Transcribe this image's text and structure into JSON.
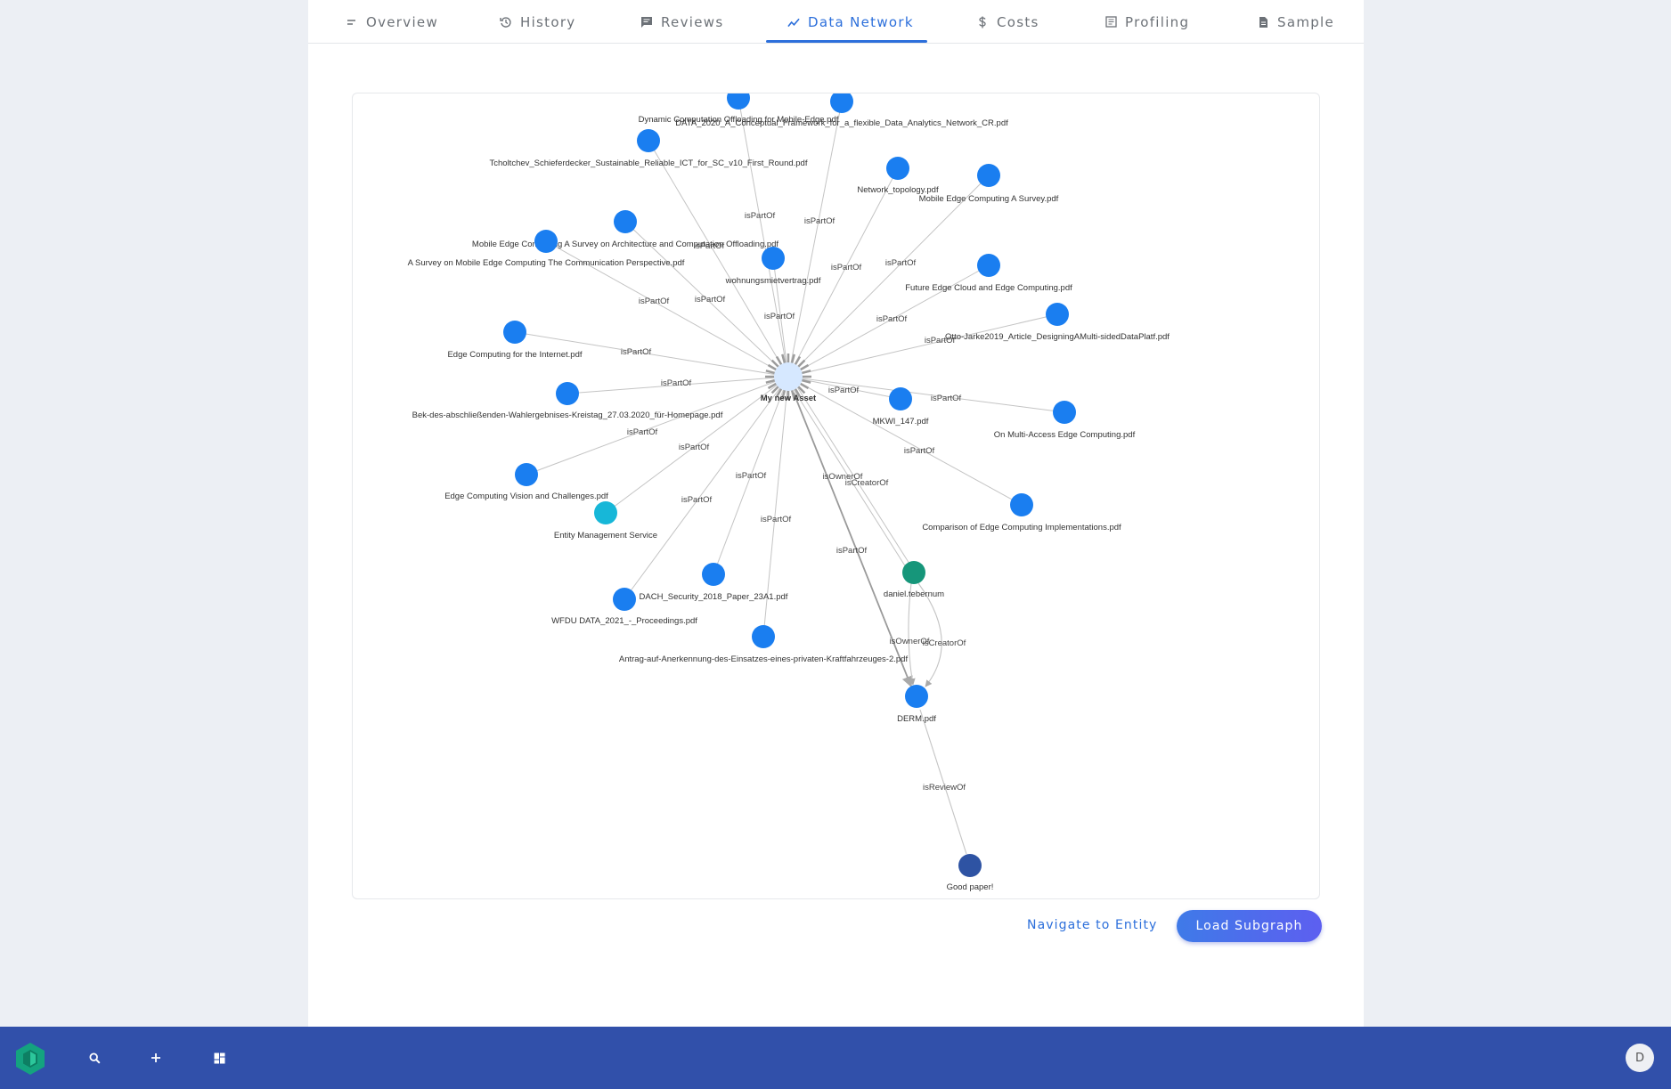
{
  "tabs": [
    {
      "label": "Overview",
      "icon": "notes-icon"
    },
    {
      "label": "History",
      "icon": "history-icon"
    },
    {
      "label": "Reviews",
      "icon": "comment-icon"
    },
    {
      "label": "Data Network",
      "icon": "trending-icon",
      "active": true
    },
    {
      "label": "Costs",
      "icon": "dollar-icon"
    },
    {
      "label": "Profiling",
      "icon": "profiling-icon"
    },
    {
      "label": "Sample",
      "icon": "file-icon"
    }
  ],
  "graph": {
    "center": {
      "label": "My new Asset"
    },
    "nodes": [
      {
        "id": "n1",
        "label": "Dynamic Computation Offloading for Mobile-Edge.pdf",
        "kind": "document"
      },
      {
        "id": "n2",
        "label": "DATA_2020_A_Conceptual_Framework_for_a_flexible_Data_Analytics_Network_CR.pdf",
        "kind": "document"
      },
      {
        "id": "n3",
        "label": "Tcholtchev_Schieferdecker_Sustainable_Reliable_ICT_for_SC_v10_First_Round.pdf",
        "kind": "document"
      },
      {
        "id": "n4",
        "label": "Network_topology.pdf",
        "kind": "document"
      },
      {
        "id": "n5",
        "label": "Mobile Edge Computing A Survey.pdf",
        "kind": "document"
      },
      {
        "id": "n6",
        "label": "Mobile Edge Computing A Survey on Architecture and Computation Offloading.pdf",
        "kind": "document"
      },
      {
        "id": "n7",
        "label": "A Survey on Mobile Edge Computing The Communication Perspective.pdf",
        "kind": "document"
      },
      {
        "id": "n8",
        "label": "wohnungsmietvertrag.pdf",
        "kind": "document"
      },
      {
        "id": "n9",
        "label": "Future Edge Cloud and Edge Computing.pdf",
        "kind": "document"
      },
      {
        "id": "n10",
        "label": "Otto-Jarke2019_Article_DesigningAMulti-sidedDataPlatf.pdf",
        "kind": "document"
      },
      {
        "id": "n11",
        "label": "Edge Computing for the Internet.pdf",
        "kind": "document"
      },
      {
        "id": "n12",
        "label": "Bek-des-abschließenden-Wahlergebnises-Kreistag_27.03.2020_für-Homepage.pdf",
        "kind": "document"
      },
      {
        "id": "n13",
        "label": "MKWI_147.pdf",
        "kind": "document"
      },
      {
        "id": "n14",
        "label": "On Multi-Access Edge Computing.pdf",
        "kind": "document"
      },
      {
        "id": "n15",
        "label": "Edge Computing Vision and Challenges.pdf",
        "kind": "document"
      },
      {
        "id": "n16",
        "label": "Entity Management Service",
        "kind": "service"
      },
      {
        "id": "n17",
        "label": "Comparison of Edge Computing Implementations.pdf",
        "kind": "document"
      },
      {
        "id": "n18",
        "label": "daniel.tebernum",
        "kind": "user"
      },
      {
        "id": "n19",
        "label": "DACH_Security_2018_Paper_23A1.pdf",
        "kind": "document"
      },
      {
        "id": "n20",
        "label": "WFDU DATA_2021_-_Proceedings.pdf",
        "kind": "document"
      },
      {
        "id": "n21",
        "label": "Antrag-auf-Anerkennung-des-Einsatzes-eines-privaten-Kraftfahrzeuges-2.pdf",
        "kind": "document"
      },
      {
        "id": "n22",
        "label": "DERM.pdf",
        "kind": "document"
      },
      {
        "id": "n23",
        "label": "Good paper!",
        "kind": "review"
      }
    ],
    "edge_labels": {
      "part_of": "isPartOf",
      "owner_of": "isOwnerOf",
      "creator_of": "isCreatorOf",
      "review_of": "isReviewOf"
    },
    "colors": {
      "document": "#1a7ef0",
      "service": "#17b7d8",
      "user": "#16967a",
      "review": "#2e53a3",
      "center": "#d6e8ff",
      "edge": "#c4c4c4"
    }
  },
  "actions": {
    "navigate_label": "Navigate to Entity",
    "load_label": "Load Subgraph"
  },
  "bottom_bar": {
    "avatar_initial": "D",
    "brand_color": "#3150aa"
  }
}
